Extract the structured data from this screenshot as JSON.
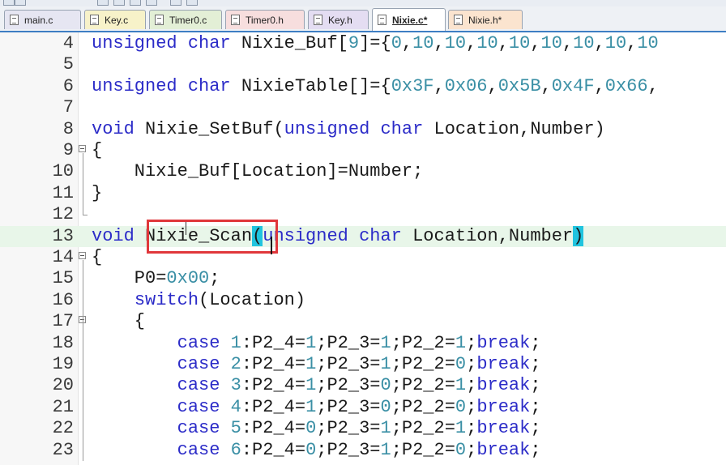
{
  "tabs": [
    {
      "label": "main.c",
      "color": "#e6e6f2"
    },
    {
      "label": "Key.c",
      "color": "#f7f2c9"
    },
    {
      "label": "Timer0.c",
      "color": "#e3efd6"
    },
    {
      "label": "Timer0.h",
      "color": "#f7dede"
    },
    {
      "label": "Key.h",
      "color": "#e4ddf2"
    },
    {
      "label": "Nixie.c*",
      "color": "#ffffff",
      "active": true
    },
    {
      "label": "Nixie.h*",
      "color": "#fbe4cf"
    }
  ],
  "lines": [
    {
      "num": "4",
      "fold": "",
      "tokens": [
        {
          "t": "kw",
          "v": "unsigned"
        },
        {
          "t": "",
          "v": " "
        },
        {
          "t": "kw",
          "v": "char"
        },
        {
          "t": "",
          "v": " Nixie_Buf["
        },
        {
          "t": "num",
          "v": "9"
        },
        {
          "t": "",
          "v": "]={"
        },
        {
          "t": "num",
          "v": "0"
        },
        {
          "t": "",
          "v": ","
        },
        {
          "t": "num",
          "v": "10"
        },
        {
          "t": "",
          "v": ","
        },
        {
          "t": "num",
          "v": "10"
        },
        {
          "t": "",
          "v": ","
        },
        {
          "t": "num",
          "v": "10"
        },
        {
          "t": "",
          "v": ","
        },
        {
          "t": "num",
          "v": "10"
        },
        {
          "t": "",
          "v": ","
        },
        {
          "t": "num",
          "v": "10"
        },
        {
          "t": "",
          "v": ","
        },
        {
          "t": "num",
          "v": "10"
        },
        {
          "t": "",
          "v": ","
        },
        {
          "t": "num",
          "v": "10"
        },
        {
          "t": "",
          "v": ","
        },
        {
          "t": "num",
          "v": "10"
        }
      ]
    },
    {
      "num": "5",
      "fold": "",
      "tokens": []
    },
    {
      "num": "6",
      "fold": "",
      "tokens": [
        {
          "t": "kw",
          "v": "unsigned"
        },
        {
          "t": "",
          "v": " "
        },
        {
          "t": "kw",
          "v": "char"
        },
        {
          "t": "",
          "v": " NixieTable[]={"
        },
        {
          "t": "num",
          "v": "0x3F"
        },
        {
          "t": "",
          "v": ","
        },
        {
          "t": "num",
          "v": "0x06"
        },
        {
          "t": "",
          "v": ","
        },
        {
          "t": "num",
          "v": "0x5B"
        },
        {
          "t": "",
          "v": ","
        },
        {
          "t": "num",
          "v": "0x4F"
        },
        {
          "t": "",
          "v": ","
        },
        {
          "t": "num",
          "v": "0x66"
        },
        {
          "t": "",
          "v": ","
        }
      ]
    },
    {
      "num": "7",
      "fold": "",
      "tokens": []
    },
    {
      "num": "8",
      "fold": "",
      "tokens": [
        {
          "t": "kw",
          "v": "void"
        },
        {
          "t": "",
          "v": " Nixie_SetBuf("
        },
        {
          "t": "kw",
          "v": "unsigned"
        },
        {
          "t": "",
          "v": " "
        },
        {
          "t": "kw",
          "v": "char"
        },
        {
          "t": "",
          "v": " Location,Number)"
        }
      ]
    },
    {
      "num": "9",
      "fold": "open",
      "tokens": [
        {
          "t": "",
          "v": "{"
        }
      ]
    },
    {
      "num": "10",
      "fold": "",
      "tokens": [
        {
          "t": "",
          "v": "    Nixie_Buf[Location]=Number;"
        }
      ]
    },
    {
      "num": "11",
      "fold": "",
      "tokens": [
        {
          "t": "",
          "v": "}"
        }
      ]
    },
    {
      "num": "12",
      "fold": "end",
      "tokens": []
    },
    {
      "num": "13",
      "fold": "",
      "hl": true,
      "tokens": [
        {
          "t": "kw",
          "v": "void"
        },
        {
          "t": "",
          "v": " Nixie_Scan"
        },
        {
          "t": "brace",
          "v": "("
        },
        {
          "t": "kw",
          "v": "unsigned"
        },
        {
          "t": "",
          "v": " "
        },
        {
          "t": "kw",
          "v": "char"
        },
        {
          "t": "",
          "v": " Location,Number"
        },
        {
          "t": "brace",
          "v": ")"
        }
      ]
    },
    {
      "num": "14",
      "fold": "open",
      "tokens": [
        {
          "t": "",
          "v": "{"
        }
      ]
    },
    {
      "num": "15",
      "fold": "",
      "tokens": [
        {
          "t": "",
          "v": "    P0="
        },
        {
          "t": "num",
          "v": "0x00"
        },
        {
          "t": "",
          "v": ";"
        }
      ]
    },
    {
      "num": "16",
      "fold": "",
      "tokens": [
        {
          "t": "",
          "v": "    "
        },
        {
          "t": "kw",
          "v": "switch"
        },
        {
          "t": "",
          "v": "(Location)"
        }
      ]
    },
    {
      "num": "17",
      "fold": "open",
      "tokens": [
        {
          "t": "",
          "v": "    {"
        }
      ]
    },
    {
      "num": "18",
      "fold": "",
      "tokens": [
        {
          "t": "",
          "v": "        "
        },
        {
          "t": "kw",
          "v": "case"
        },
        {
          "t": "",
          "v": " "
        },
        {
          "t": "num",
          "v": "1"
        },
        {
          "t": "",
          "v": ":P2_4="
        },
        {
          "t": "num",
          "v": "1"
        },
        {
          "t": "",
          "v": ";P2_3="
        },
        {
          "t": "num",
          "v": "1"
        },
        {
          "t": "",
          "v": ";P2_2="
        },
        {
          "t": "num",
          "v": "1"
        },
        {
          "t": "",
          "v": ";"
        },
        {
          "t": "kw",
          "v": "break"
        },
        {
          "t": "",
          "v": ";"
        }
      ]
    },
    {
      "num": "19",
      "fold": "",
      "tokens": [
        {
          "t": "",
          "v": "        "
        },
        {
          "t": "kw",
          "v": "case"
        },
        {
          "t": "",
          "v": " "
        },
        {
          "t": "num",
          "v": "2"
        },
        {
          "t": "",
          "v": ":P2_4="
        },
        {
          "t": "num",
          "v": "1"
        },
        {
          "t": "",
          "v": ";P2_3="
        },
        {
          "t": "num",
          "v": "1"
        },
        {
          "t": "",
          "v": ";P2_2="
        },
        {
          "t": "num",
          "v": "0"
        },
        {
          "t": "",
          "v": ";"
        },
        {
          "t": "kw",
          "v": "break"
        },
        {
          "t": "",
          "v": ";"
        }
      ]
    },
    {
      "num": "20",
      "fold": "",
      "tokens": [
        {
          "t": "",
          "v": "        "
        },
        {
          "t": "kw",
          "v": "case"
        },
        {
          "t": "",
          "v": " "
        },
        {
          "t": "num",
          "v": "3"
        },
        {
          "t": "",
          "v": ":P2_4="
        },
        {
          "t": "num",
          "v": "1"
        },
        {
          "t": "",
          "v": ";P2_3="
        },
        {
          "t": "num",
          "v": "0"
        },
        {
          "t": "",
          "v": ";P2_2="
        },
        {
          "t": "num",
          "v": "1"
        },
        {
          "t": "",
          "v": ";"
        },
        {
          "t": "kw",
          "v": "break"
        },
        {
          "t": "",
          "v": ";"
        }
      ]
    },
    {
      "num": "21",
      "fold": "",
      "tokens": [
        {
          "t": "",
          "v": "        "
        },
        {
          "t": "kw",
          "v": "case"
        },
        {
          "t": "",
          "v": " "
        },
        {
          "t": "num",
          "v": "4"
        },
        {
          "t": "",
          "v": ":P2_4="
        },
        {
          "t": "num",
          "v": "1"
        },
        {
          "t": "",
          "v": ";P2_3="
        },
        {
          "t": "num",
          "v": "0"
        },
        {
          "t": "",
          "v": ";P2_2="
        },
        {
          "t": "num",
          "v": "0"
        },
        {
          "t": "",
          "v": ";"
        },
        {
          "t": "kw",
          "v": "break"
        },
        {
          "t": "",
          "v": ";"
        }
      ]
    },
    {
      "num": "22",
      "fold": "",
      "tokens": [
        {
          "t": "",
          "v": "        "
        },
        {
          "t": "kw",
          "v": "case"
        },
        {
          "t": "",
          "v": " "
        },
        {
          "t": "num",
          "v": "5"
        },
        {
          "t": "",
          "v": ":P2_4="
        },
        {
          "t": "num",
          "v": "0"
        },
        {
          "t": "",
          "v": ";P2_3="
        },
        {
          "t": "num",
          "v": "1"
        },
        {
          "t": "",
          "v": ";P2_2="
        },
        {
          "t": "num",
          "v": "1"
        },
        {
          "t": "",
          "v": ";"
        },
        {
          "t": "kw",
          "v": "break"
        },
        {
          "t": "",
          "v": ";"
        }
      ]
    },
    {
      "num": "23",
      "fold": "",
      "tokens": [
        {
          "t": "",
          "v": "        "
        },
        {
          "t": "kw",
          "v": "case"
        },
        {
          "t": "",
          "v": " "
        },
        {
          "t": "num",
          "v": "6"
        },
        {
          "t": "",
          "v": ":P2_4="
        },
        {
          "t": "num",
          "v": "0"
        },
        {
          "t": "",
          "v": ";P2_3="
        },
        {
          "t": "num",
          "v": "1"
        },
        {
          "t": "",
          "v": ";P2_2="
        },
        {
          "t": "num",
          "v": "0"
        },
        {
          "t": "",
          "v": ";"
        },
        {
          "t": "kw",
          "v": "break"
        },
        {
          "t": "",
          "v": ";"
        }
      ]
    }
  ],
  "colors": {
    "keyword": "#2c2cc8",
    "number": "#3a8fa5",
    "current_line": "#e8f6e9",
    "brace_match": "#21c4df",
    "selection_box": "#e0373b"
  }
}
